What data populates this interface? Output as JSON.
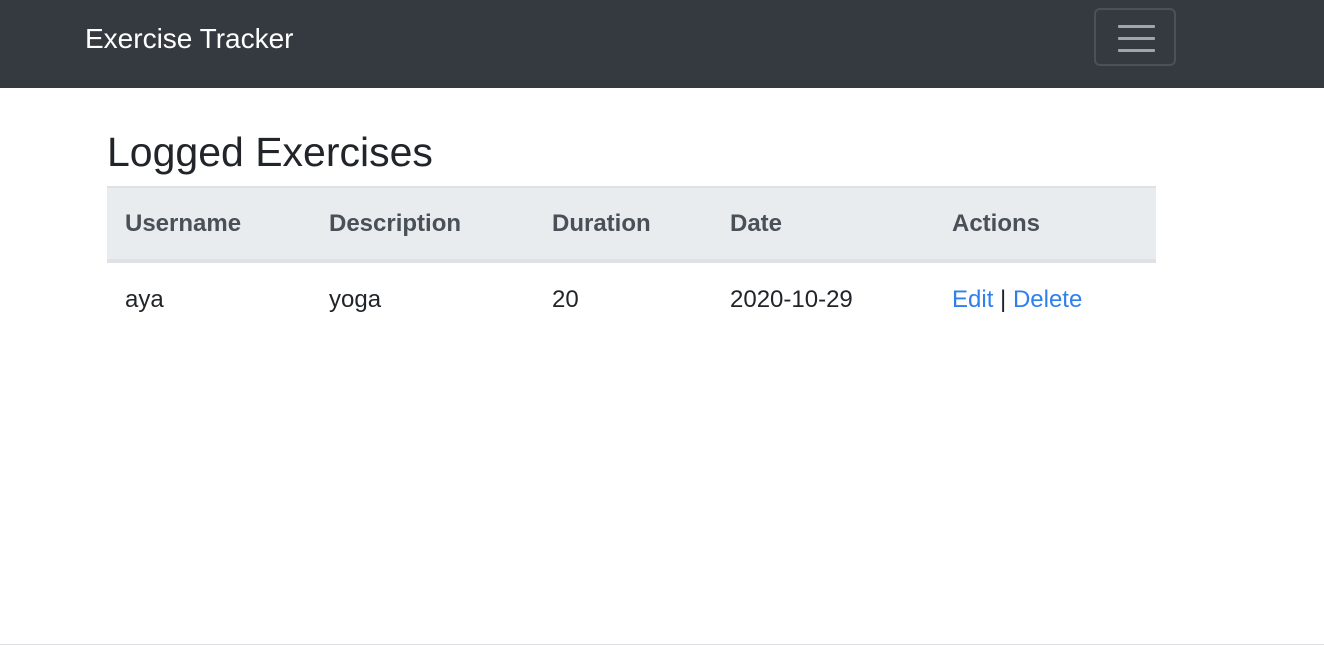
{
  "navbar": {
    "brand": "Exercise Tracker",
    "toggler_icon": "hamburger-menu-icon"
  },
  "main": {
    "title": "Logged Exercises",
    "table": {
      "headers": [
        "Username",
        "Description",
        "Duration",
        "Date",
        "Actions"
      ],
      "rows": [
        {
          "username": "aya",
          "description": "yoga",
          "duration": "20",
          "date": "2020-10-29",
          "edit_label": "Edit",
          "separator": "|",
          "delete_label": "Delete"
        }
      ]
    }
  },
  "colors": {
    "navbar_bg": "#343a40",
    "header_bg": "#e9ecef",
    "link": "#2f80ed"
  }
}
